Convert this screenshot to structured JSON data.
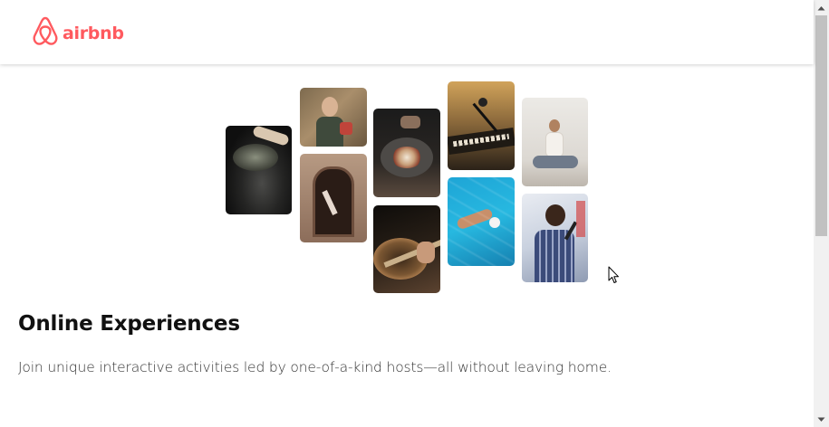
{
  "header": {
    "logo_text": "airbnb",
    "logo_icon": "airbnb-belo-icon",
    "brand_color": "#FF5A5F"
  },
  "hero": {
    "photos": [
      {
        "name": "photo-cooking-pan",
        "subject": "cooking-pan"
      },
      {
        "name": "photo-woman-holding-food",
        "subject": "woman-holding-food"
      },
      {
        "name": "photo-dancer-doorway",
        "subject": "dancer-doorway"
      },
      {
        "name": "photo-plated-dish",
        "subject": "plated-dish"
      },
      {
        "name": "photo-guitar-player",
        "subject": "guitar-player"
      },
      {
        "name": "photo-keyboard-microphone",
        "subject": "keyboard-microphone"
      },
      {
        "name": "photo-swimmer-pool",
        "subject": "swimmer-pool"
      },
      {
        "name": "photo-meditation",
        "subject": "meditation"
      },
      {
        "name": "photo-singer",
        "subject": "singer"
      }
    ]
  },
  "main": {
    "title": "Online Experiences",
    "subtitle": "Join unique interactive activities led by one-of-a-kind hosts—all without leaving home."
  },
  "scrollbar": {
    "up_icon": "scroll-up-arrow-icon",
    "down_icon": "scroll-down-arrow-icon"
  }
}
